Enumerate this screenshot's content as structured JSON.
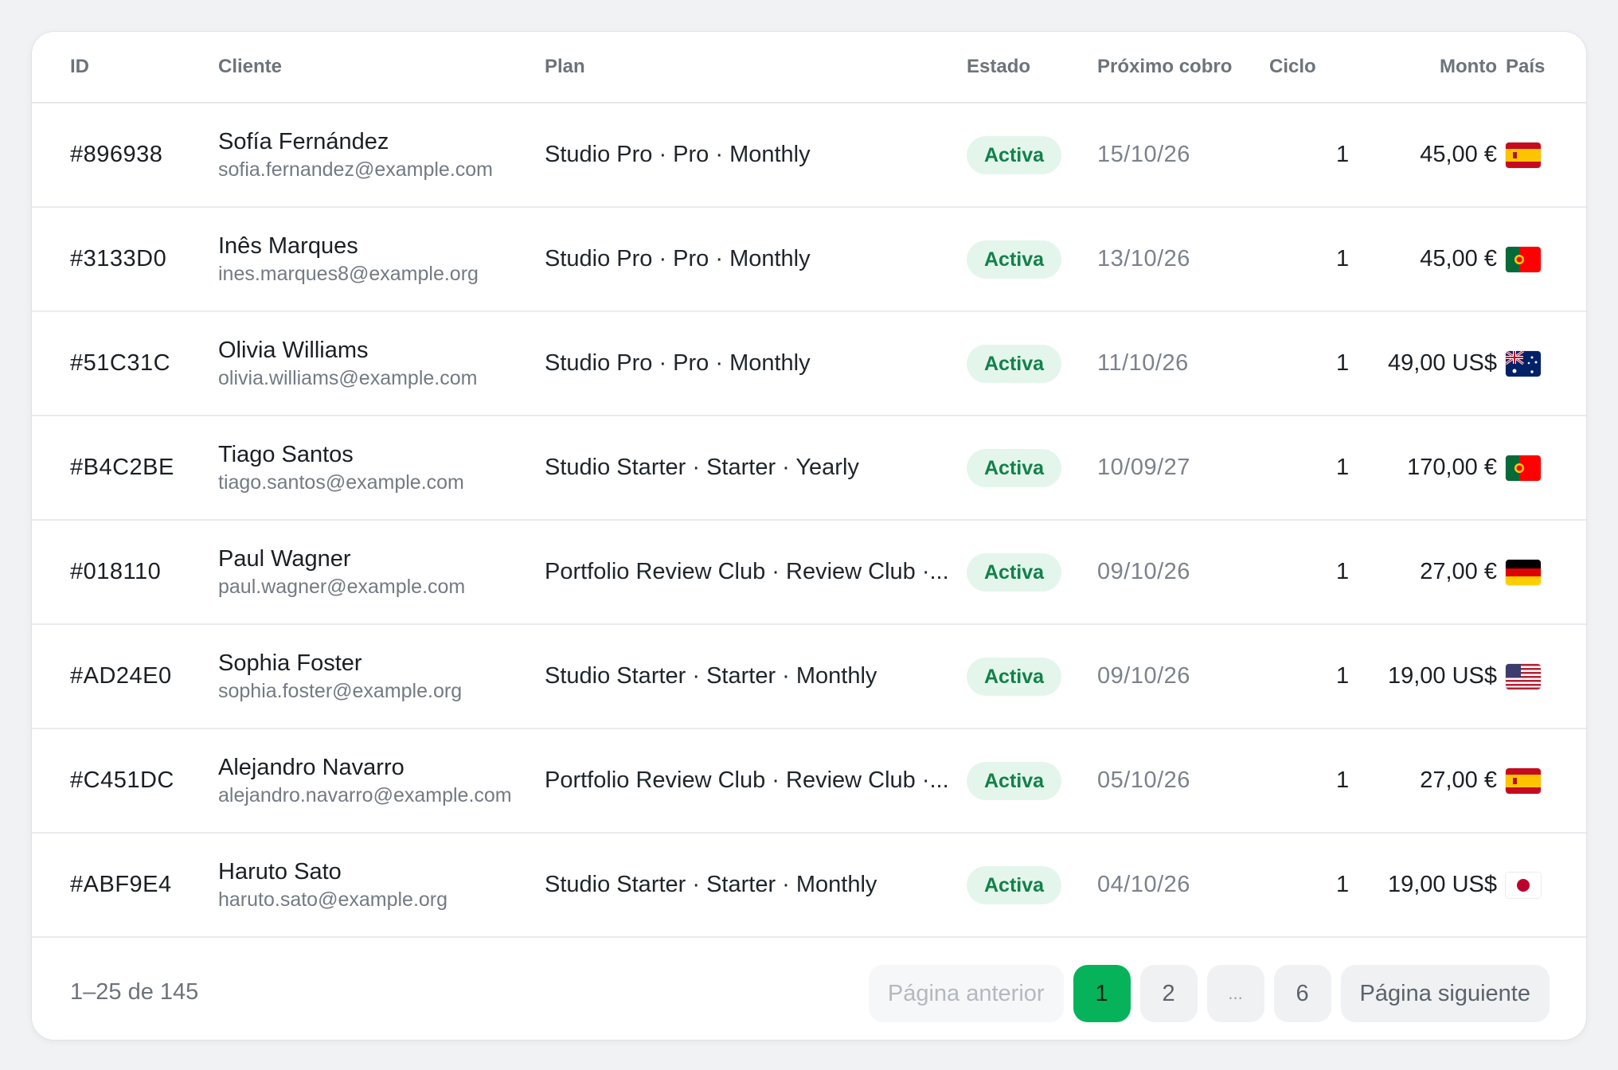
{
  "table": {
    "headers": {
      "id": "ID",
      "client": "Cliente",
      "plan": "Plan",
      "status": "Estado",
      "next_charge": "Próximo cobro",
      "cycle": "Ciclo",
      "amount": "Monto",
      "country": "País"
    },
    "rows": [
      {
        "id": "#896938",
        "name": "Sofía Fernández",
        "email": "sofia.fernandez@example.com",
        "plan": "Studio Pro · Pro · Monthly",
        "status": "Activa",
        "next_charge": "15/10/26",
        "cycle": "1",
        "amount": "45,00 €",
        "flag": "spain-flag"
      },
      {
        "id": "#3133D0",
        "name": "Inês Marques",
        "email": "ines.marques8@example.org",
        "plan": "Studio Pro · Pro · Monthly",
        "status": "Activa",
        "next_charge": "13/10/26",
        "cycle": "1",
        "amount": "45,00 €",
        "flag": "portugal-flag"
      },
      {
        "id": "#51C31C",
        "name": "Olivia Williams",
        "email": "olivia.williams@example.com",
        "plan": "Studio Pro · Pro · Monthly",
        "status": "Activa",
        "next_charge": "11/10/26",
        "cycle": "1",
        "amount": "49,00 US$",
        "flag": "australia-flag"
      },
      {
        "id": "#B4C2BE",
        "name": "Tiago Santos",
        "email": "tiago.santos@example.com",
        "plan": "Studio Starter · Starter · Yearly",
        "status": "Activa",
        "next_charge": "10/09/27",
        "cycle": "1",
        "amount": "170,00 €",
        "flag": "portugal-flag"
      },
      {
        "id": "#018110",
        "name": "Paul Wagner",
        "email": "paul.wagner@example.com",
        "plan": "Portfolio Review Club · Review Club ·...",
        "status": "Activa",
        "next_charge": "09/10/26",
        "cycle": "1",
        "amount": "27,00 €",
        "flag": "germany-flag"
      },
      {
        "id": "#AD24E0",
        "name": "Sophia Foster",
        "email": "sophia.foster@example.org",
        "plan": "Studio Starter · Starter · Monthly",
        "status": "Activa",
        "next_charge": "09/10/26",
        "cycle": "1",
        "amount": "19,00 US$",
        "flag": "usa-flag"
      },
      {
        "id": "#C451DC",
        "name": "Alejandro Navarro",
        "email": "alejandro.navarro@example.com",
        "plan": "Portfolio Review Club · Review Club ·...",
        "status": "Activa",
        "next_charge": "05/10/26",
        "cycle": "1",
        "amount": "27,00 €",
        "flag": "spain-flag"
      },
      {
        "id": "#ABF9E4",
        "name": "Haruto Sato",
        "email": "haruto.sato@example.org",
        "plan": "Studio Starter · Starter · Monthly",
        "status": "Activa",
        "next_charge": "04/10/26",
        "cycle": "1",
        "amount": "19,00 US$",
        "flag": "japan-flag"
      }
    ]
  },
  "footer": {
    "range": "1–25 de 145",
    "prev_label": "Página anterior",
    "next_label": "Página siguiente",
    "pages": [
      "1",
      "2",
      "...",
      "6"
    ],
    "current_page": "1"
  },
  "colors": {
    "accent": "#06b35a",
    "badge_bg": "#e4f6ec",
    "badge_text": "#12814a"
  }
}
